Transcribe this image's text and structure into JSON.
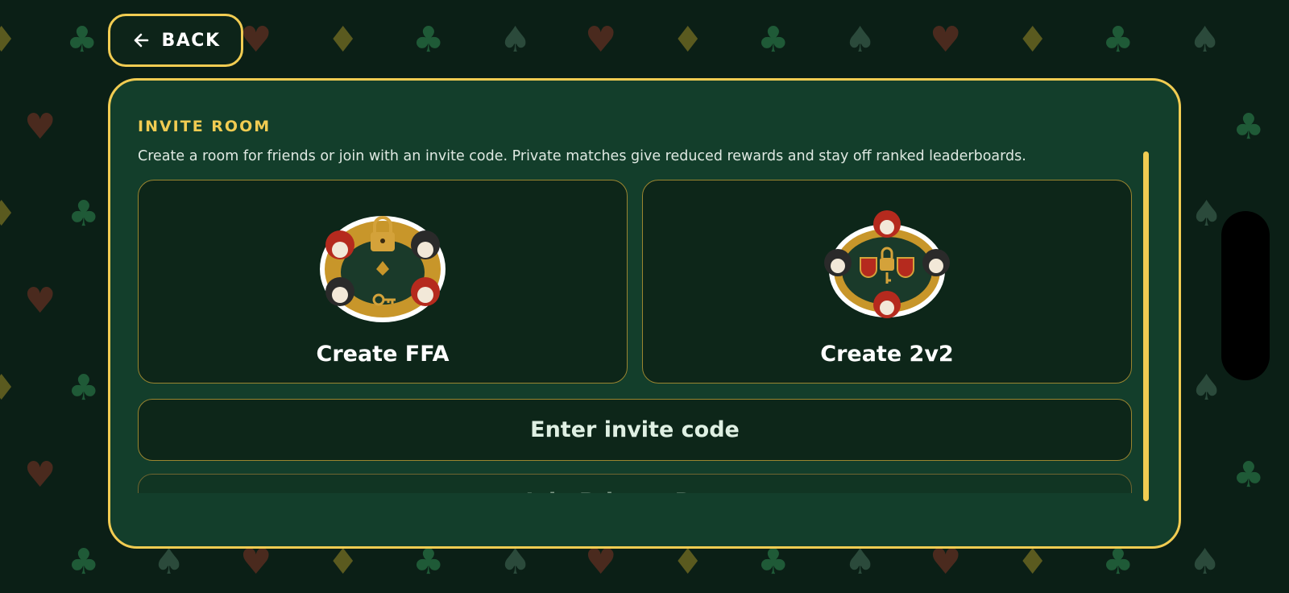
{
  "back_button": {
    "label": "BACK",
    "icon": "arrow-left-icon"
  },
  "invite_room": {
    "title": "INVITE ROOM",
    "description": "Create a room for friends or join with an invite code. Private matches give reduced rewards and stay off ranked leaderboards.",
    "cards": [
      {
        "label": "Create FFA",
        "art": "jester-table-lock-emblem"
      },
      {
        "label": "Create 2v2",
        "art": "jester-duo-shield-emblem"
      }
    ],
    "enter_code_label": "Enter invite code",
    "join_label": "Join Private Room"
  },
  "colors": {
    "accent": "#f1cc52",
    "background": "#0b1f16",
    "panel": "#133e2b",
    "card": "#0d2619"
  }
}
